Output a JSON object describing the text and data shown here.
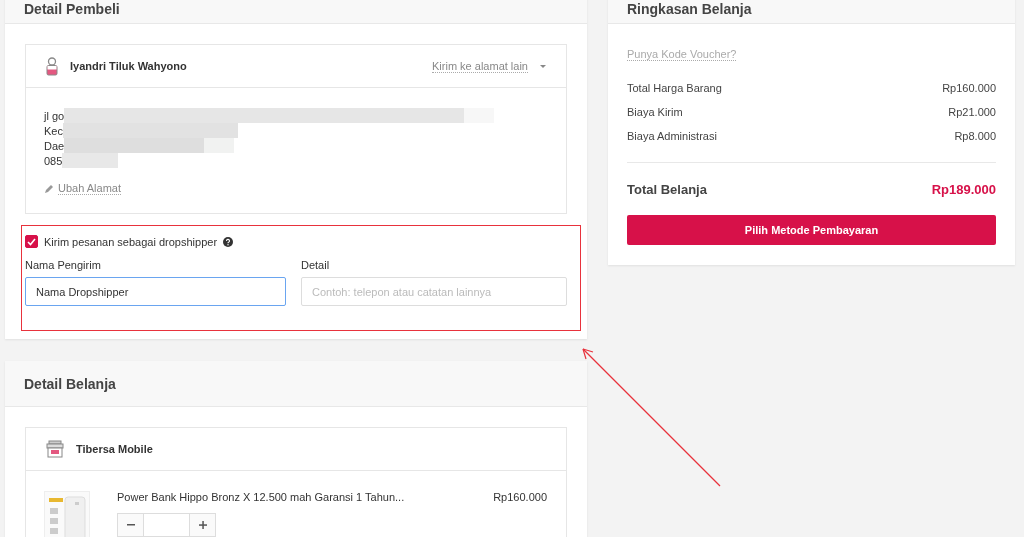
{
  "buyer_section": {
    "title": "Detail Pembeli",
    "address_card": {
      "name": "Iyandri Tiluk Wahyono",
      "change_link": "Kirim ke alamat lain",
      "address_lines": [
        "jl go",
        "Kec",
        "Dae",
        "085"
      ],
      "edit_link": "Ubah Alamat"
    },
    "dropshipper": {
      "label": "Kirim pesanan sebagai dropshipper",
      "checked": true,
      "sender_label": "Nama Pengirim",
      "sender_value": "Nama Dropshipper",
      "detail_label": "Detail",
      "detail_placeholder": "Contoh: telepon atau catatan lainnya"
    }
  },
  "order_section": {
    "title": "Detail Belanja",
    "shop": {
      "name": "Tibersa Mobile",
      "items": [
        {
          "name": "Power Bank Hippo Bronz X 12.500 mah Garansi 1 Tahun...",
          "price": "Rp160.000"
        }
      ]
    }
  },
  "summary": {
    "title": "Ringkasan Belanja",
    "voucher_link": "Punya Kode Voucher?",
    "rows": [
      {
        "label": "Total Harga Barang",
        "value": "Rp160.000"
      },
      {
        "label": "Biaya Kirim",
        "value": "Rp21.000"
      },
      {
        "label": "Biaya Administrasi",
        "value": "Rp8.000"
      }
    ],
    "total_label": "Total Belanja",
    "total_value": "Rp189.000",
    "pay_button": "Pilih Metode Pembayaran"
  }
}
